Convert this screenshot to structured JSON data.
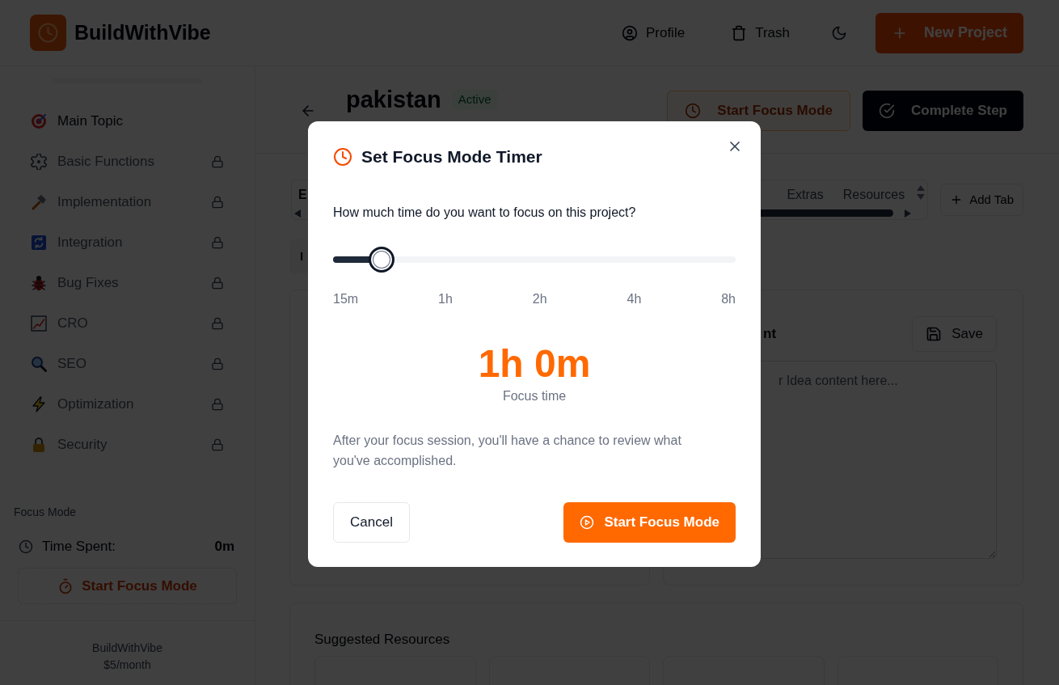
{
  "header": {
    "brand": "BuildWithVibe",
    "nav": [
      {
        "label": "Profile"
      },
      {
        "label": "Trash"
      }
    ],
    "new_project": "New Project"
  },
  "sidebar": {
    "items": [
      {
        "label": "Main Topic",
        "locked": false
      },
      {
        "label": "Basic Functions",
        "locked": true
      },
      {
        "label": "Implementation",
        "locked": true
      },
      {
        "label": "Integration",
        "locked": true
      },
      {
        "label": "Bug Fixes",
        "locked": true
      },
      {
        "label": "CRO",
        "locked": true
      },
      {
        "label": "SEO",
        "locked": true
      },
      {
        "label": "Optimization",
        "locked": true
      },
      {
        "label": "Security",
        "locked": true
      }
    ],
    "focus_mode": {
      "heading": "Focus Mode",
      "time_label": "Time Spent:",
      "time_value": "0m",
      "button": "Start Focus Mode"
    },
    "footer": {
      "product": "BuildWithVibe",
      "price": "$5/month"
    }
  },
  "project": {
    "title": "pakistan",
    "status": "Active",
    "focus_button": "Start Focus Mode",
    "complete_button": "Complete Step"
  },
  "tabs": {
    "items": [
      {
        "label": "E",
        "selected": true
      },
      {
        "label": "Extras",
        "selected": false
      },
      {
        "label": "Resources",
        "selected": false
      }
    ],
    "add_button": "Add Tab"
  },
  "section_tab": {
    "label": "I"
  },
  "editor": {
    "heading": "nt",
    "save_button": "Save",
    "placeholder": "r Idea content here..."
  },
  "resources": {
    "heading": "Suggested Resources"
  },
  "dialog": {
    "title": "Set Focus Mode Timer",
    "question": "How much time do you want to focus on this project?",
    "slider": {
      "level": 0.12
    },
    "ticks": [
      "15m",
      "1h",
      "2h",
      "4h",
      "8h"
    ],
    "duration": "1h 0m",
    "duration_caption": "Focus time",
    "note": "After your focus session, you'll have a chance to review what you've accomplished.",
    "buttons": [
      {
        "label": "Cancel",
        "kind": "secondary"
      },
      {
        "label": "Start Focus Mode",
        "kind": "primary"
      }
    ]
  }
}
